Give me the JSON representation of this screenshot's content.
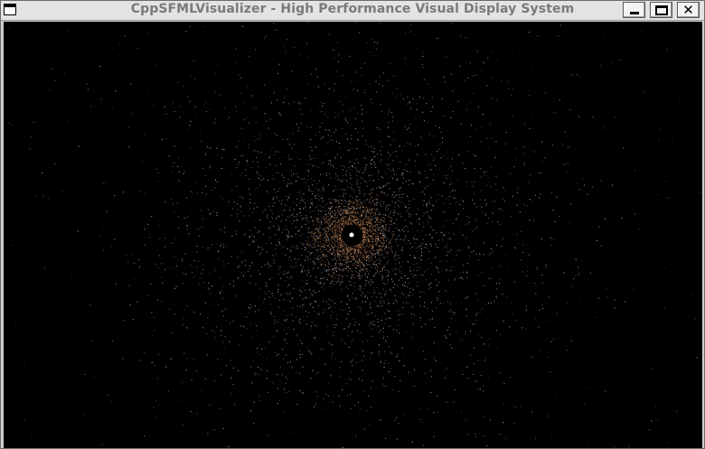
{
  "window": {
    "title": "CppSFMLVisualizer - High Performance Visual Display System",
    "controls": {
      "minimize_icon": "minimize-icon",
      "maximize_icon": "maximize-icon",
      "close_icon": "close-icon",
      "close_glyph": "✕"
    }
  },
  "scene": {
    "type": "particle-galaxy",
    "background_color": "#000000",
    "core_color": "#ffffff",
    "inner_ring_color": "#c98a5e",
    "outer_particle_colors": [
      "#8a8fb0",
      "#9a9ab8",
      "#b0a0a0",
      "#7d8aa6",
      "#a89a8c"
    ]
  }
}
